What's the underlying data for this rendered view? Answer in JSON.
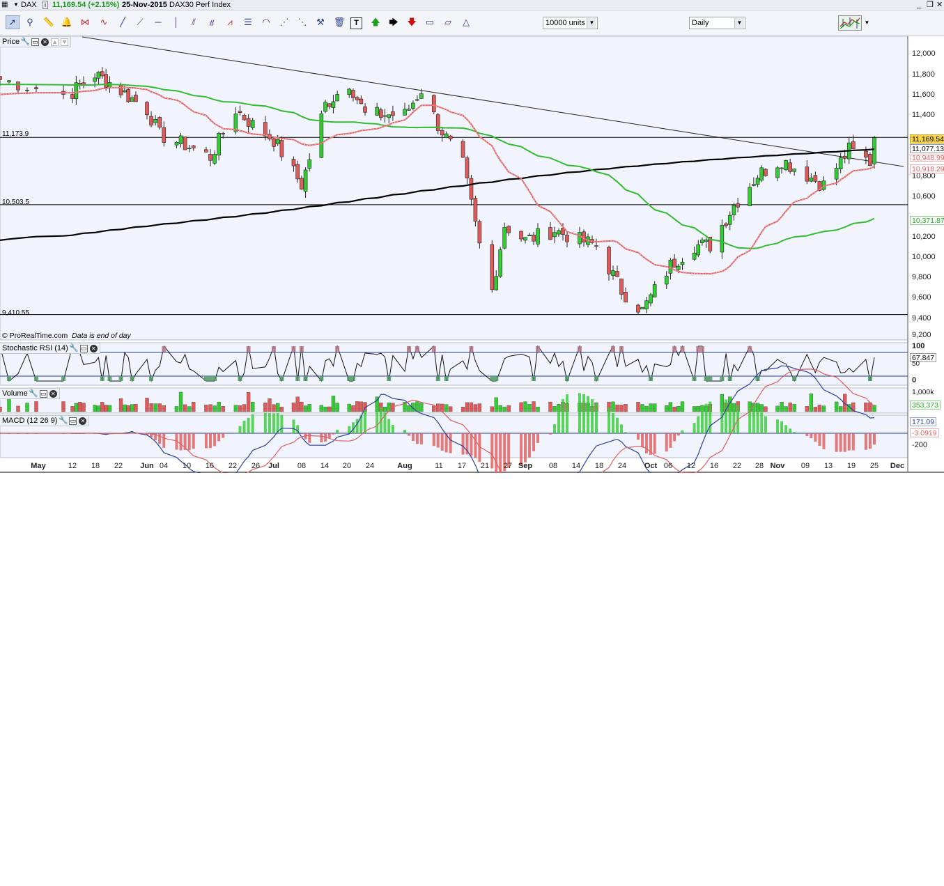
{
  "titlebar": {
    "symbol": "DAX",
    "last_change": "11,169.54 (+2.15%)",
    "date": "25-Nov-2015",
    "instrument": "DAX30 Perf Index",
    "window_controls": [
      "_",
      "❐",
      "✕"
    ]
  },
  "toolbar": {
    "size_dropdown": "10000 units",
    "period_dropdown": "Daily"
  },
  "panels": {
    "price": {
      "title": "Price"
    },
    "stoch": {
      "title": "Stochastic RSI (14)"
    },
    "volume": {
      "title": "Volume"
    },
    "macd": {
      "title": "MACD (12 26 9)"
    }
  },
  "levels": {
    "h1": "11,173.9",
    "h2": "10,503.5",
    "h3": "9,410.55"
  },
  "credit": {
    "site": "© ProRealTime.com",
    "note": "Data is end of day"
  },
  "price_axis": [
    "12,000",
    "11,800",
    "11,600",
    "11,400",
    "10,800",
    "10,600",
    "10,200",
    "10,000",
    "9,800",
    "9,600",
    "9,400",
    "9,200"
  ],
  "price_tags": {
    "last": "11,169.54",
    "ma200": "11,077.13",
    "ma20": "10,918.29",
    "ma20_hidden": "10,948.99",
    "ma50": "10,371.87"
  },
  "stoch_axis": {
    "top": "100",
    "mid": "50",
    "bottom": "0",
    "value": "67.847"
  },
  "volume_axis": {
    "top": "1,000k",
    "value": "353,373"
  },
  "macd_axis": {
    "macd": "171.09",
    "signal": "-3.0919",
    "low": "-200"
  },
  "x_axis": [
    {
      "t": "May",
      "bold": true
    },
    {
      "t": "12"
    },
    {
      "t": "18"
    },
    {
      "t": "22"
    },
    {
      "t": "Jun",
      "bold": true
    },
    {
      "t": "04"
    },
    {
      "t": "10"
    },
    {
      "t": "16"
    },
    {
      "t": "22"
    },
    {
      "t": "26"
    },
    {
      "t": "Jul",
      "bold": true
    },
    {
      "t": "08"
    },
    {
      "t": "14"
    },
    {
      "t": "20"
    },
    {
      "t": "24"
    },
    {
      "t": "Aug",
      "bold": true
    },
    {
      "t": "11"
    },
    {
      "t": "17"
    },
    {
      "t": "21"
    },
    {
      "t": "27"
    },
    {
      "t": "Sep",
      "bold": true
    },
    {
      "t": "08"
    },
    {
      "t": "14"
    },
    {
      "t": "18"
    },
    {
      "t": "24"
    },
    {
      "t": "Oct",
      "bold": true
    },
    {
      "t": "06"
    },
    {
      "t": "12"
    },
    {
      "t": "16"
    },
    {
      "t": "22"
    },
    {
      "t": "28"
    },
    {
      "t": "Nov",
      "bold": true
    },
    {
      "t": "09"
    },
    {
      "t": "13"
    },
    {
      "t": "19"
    },
    {
      "t": "25"
    },
    {
      "t": "Dec",
      "bold": true
    }
  ],
  "colors": {
    "up": "#33cc33",
    "down": "#e05a5a",
    "ma20": "#e06060",
    "ma50": "#33bb33",
    "ma200": "#000000",
    "panel_bg": "#f1f4fc"
  },
  "chart_data": {
    "type": "candlestick",
    "title": "DAX30 Perf Index",
    "date_range": [
      "2015-05-04",
      "2015-11-25"
    ],
    "price_ylim": [
      9200,
      12100
    ],
    "close_points": [
      [
        "2015-05-04",
        11750
      ],
      [
        "2015-05-11",
        11600
      ],
      [
        "2015-05-18",
        11800
      ],
      [
        "2015-05-22",
        11720
      ],
      [
        "2015-06-01",
        11450
      ],
      [
        "2015-06-04",
        11200
      ],
      [
        "2015-06-10",
        11100
      ],
      [
        "2015-06-16",
        10980
      ],
      [
        "2015-06-22",
        11450
      ],
      [
        "2015-06-26",
        11300
      ],
      [
        "2015-07-01",
        11150
      ],
      [
        "2015-07-08",
        10700
      ],
      [
        "2015-07-14",
        11500
      ],
      [
        "2015-07-20",
        11720
      ],
      [
        "2015-07-24",
        11400
      ],
      [
        "2015-08-03",
        11400
      ],
      [
        "2015-08-07",
        11650
      ],
      [
        "2015-08-11",
        11300
      ],
      [
        "2015-08-17",
        10900
      ],
      [
        "2015-08-21",
        10100
      ],
      [
        "2015-08-24",
        9650
      ],
      [
        "2015-08-27",
        10300
      ],
      [
        "2015-09-01",
        10150
      ],
      [
        "2015-09-08",
        10250
      ],
      [
        "2015-09-14",
        10150
      ],
      [
        "2015-09-18",
        10100
      ],
      [
        "2015-09-24",
        9650
      ],
      [
        "2015-09-29",
        9450
      ],
      [
        "2015-10-02",
        9650
      ],
      [
        "2015-10-06",
        9900
      ],
      [
        "2015-10-12",
        10100
      ],
      [
        "2015-10-16",
        10100
      ],
      [
        "2015-10-22",
        10500
      ],
      [
        "2015-10-28",
        10800
      ],
      [
        "2015-11-03",
        10950
      ],
      [
        "2015-11-09",
        10800
      ],
      [
        "2015-11-13",
        10700
      ],
      [
        "2015-11-19",
        11050
      ],
      [
        "2015-11-24",
        10930
      ],
      [
        "2015-11-25",
        11169.54
      ]
    ],
    "indicators": [
      {
        "name": "MA20",
        "last": 10918.29
      },
      {
        "name": "MA50",
        "last": 10371.87
      },
      {
        "name": "MA200",
        "last": 11077.13
      }
    ],
    "horizontal_levels": [
      11173.9,
      10503.5,
      9410.55
    ],
    "stochastic_rsi_last": 67.847,
    "volume_last": 353373,
    "macd_last": 171.09,
    "macd_signal_last": -3.0919
  }
}
